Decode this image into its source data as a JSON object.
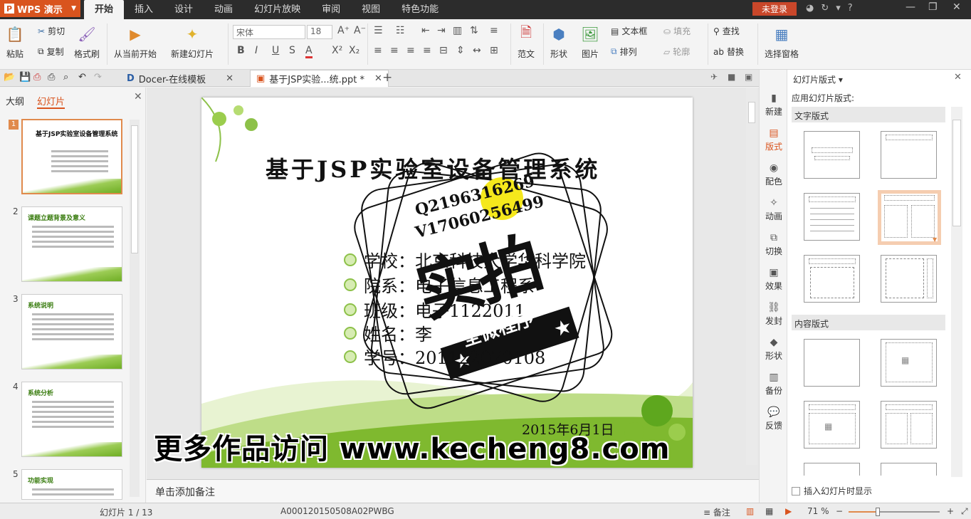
{
  "app": {
    "name": "WPS 演示",
    "logo_letter": "P"
  },
  "menu": [
    "开始",
    "插入",
    "设计",
    "动画",
    "幻灯片放映",
    "审阅",
    "视图",
    "特色功能"
  ],
  "login": "未登录",
  "ribbon": {
    "paste": "粘贴",
    "cut": "剪切",
    "copy": "复制",
    "format_painter": "格式刷",
    "from_current": "从当前开始",
    "new_slide": "新建幻灯片",
    "font_name": "宋体",
    "font_size": "18",
    "template": "范文",
    "shape": "形状",
    "picture": "图片",
    "textbox": "文本框",
    "fill": "填充",
    "arrange": "排列",
    "outline": "轮廓",
    "find": "查找",
    "replace": "替换",
    "select_pane": "选择窗格"
  },
  "doc_tabs": [
    {
      "label": "Docer-在线模板"
    },
    {
      "label": "基于JSP实验...统.ppt *"
    }
  ],
  "left_panel": {
    "tab_outline": "大纲",
    "tab_slides": "幻灯片",
    "thumbs": [
      {
        "num": "1",
        "title": "基于JSP实验室设备管理系统"
      },
      {
        "num": "2",
        "title": "课题立题背景及意义"
      },
      {
        "num": "3",
        "title": "系统说明"
      },
      {
        "num": "4",
        "title": "系统分析"
      },
      {
        "num": "5",
        "title": "功能实现"
      }
    ]
  },
  "slide": {
    "title": "基于JSP实验室设备管理系统",
    "lines": [
      "学校：北京科技大学华科学院",
      "院系：电子信息工程系",
      "班级：电子1122011",
      "姓名：李",
      "学号：20112207010​8"
    ],
    "date": "2015年6月1日",
    "stamp_contact1": "Q2196316269",
    "stamp_contact2": "V17060256499",
    "stamp_main": "实拍",
    "stamp_banner": "全微程序"
  },
  "watermark": "更多作品访问 www.kecheng8.com",
  "notes_placeholder": "单击添加备注",
  "sidebar": [
    "新建",
    "版式",
    "配色",
    "动画",
    "切换",
    "效果",
    "发封",
    "形状",
    "备份",
    "反馈"
  ],
  "layout_pane": {
    "title": "幻灯片版式",
    "subtitle": "应用幻灯片版式:",
    "section_text": "文字版式",
    "section_content": "内容版式"
  },
  "insert_check": "插入幻灯片时显示",
  "status": {
    "slide_pos": "幻灯片 1 / 13",
    "file_id": "A000120150508A02PWBG",
    "notes": "备注",
    "zoom": "71 %",
    "zoom_value": 71
  }
}
